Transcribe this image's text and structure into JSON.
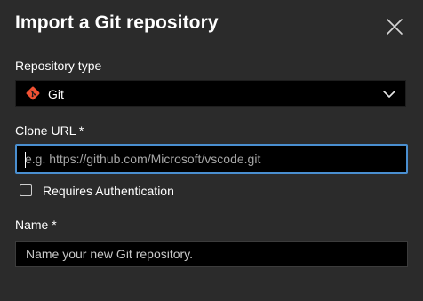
{
  "dialog": {
    "title": "Import a Git repository",
    "close_icon": "close-icon"
  },
  "repository_type": {
    "label": "Repository type",
    "selected": "Git",
    "icon": "git-icon",
    "dropdown_icon": "chevron-down-icon",
    "brand_color": "#f05133"
  },
  "clone_url": {
    "label": "Clone URL *",
    "value": "",
    "placeholder": "e.g. https://github.com/Microsoft/vscode.git",
    "focus_color": "#4a8fd0"
  },
  "requires_auth": {
    "label": "Requires Authentication",
    "checked": false
  },
  "name": {
    "label": "Name *",
    "value": "",
    "placeholder": "Name your new Git repository."
  }
}
